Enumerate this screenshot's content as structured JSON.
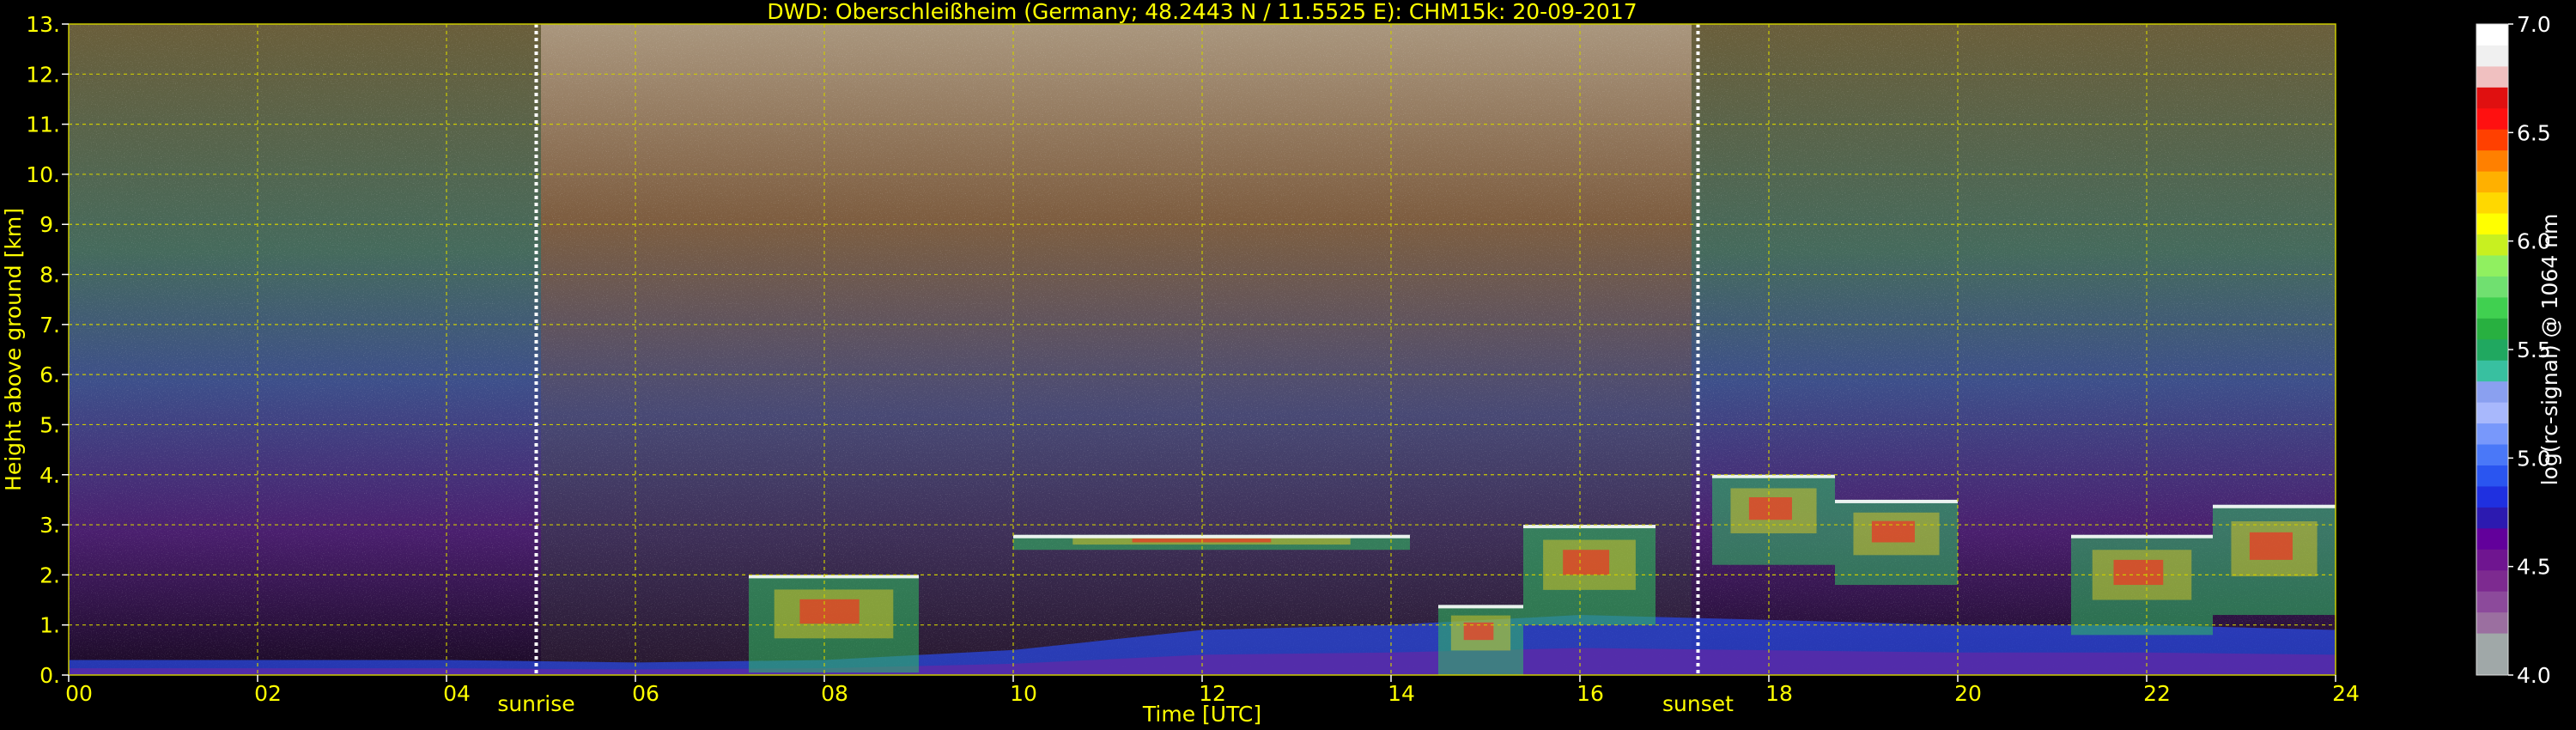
{
  "chart_data": {
    "type": "heatmap",
    "title": "DWD: Oberschleißheim (Germany; 48.2443 N / 11.5525 E):    CHM15k: 20-09-2017",
    "xlabel": "Time [UTC]",
    "ylabel": "Height above ground [km]",
    "xlim": [
      0,
      24
    ],
    "ylim": [
      0,
      13
    ],
    "x_ticks": [
      "00",
      "02",
      "04",
      "06",
      "08",
      "10",
      "12",
      "14",
      "16",
      "18",
      "20",
      "22",
      "24"
    ],
    "y_ticks": [
      "0.",
      "1.",
      "2.",
      "3.",
      "4.",
      "5.",
      "6.",
      "7.",
      "8.",
      "9.",
      "10.",
      "11.",
      "12.",
      "13."
    ],
    "grid": true,
    "annotations": [
      {
        "text": "sunrise",
        "x": 4.95
      },
      {
        "text": "sunset",
        "x": 17.25
      }
    ],
    "colorbar": {
      "label": "log(rc-signal) @ 1064 nm",
      "range": [
        4.0,
        7.0
      ],
      "ticks": [
        "4.0",
        "4.5",
        "5.0",
        "5.5",
        "6.0",
        "6.5",
        "7.0"
      ],
      "colors": [
        "#a0a8a8",
        "#a0a8a8",
        "#9b6fa0",
        "#8c4a9b",
        "#7d2a90",
        "#6f1590",
        "#62009b",
        "#2c1ab0",
        "#1f30e0",
        "#2a55f0",
        "#4a78f8",
        "#7898fb",
        "#a8b8fc",
        "#8aa0f0",
        "#38c0a0",
        "#20a860",
        "#28b040",
        "#40d050",
        "#70e070",
        "#90f060",
        "#c8f020",
        "#ffff00",
        "#ffd800",
        "#ffb000",
        "#ff8000",
        "#ff4000",
        "#ff1010",
        "#e01010",
        "#f0c0c0",
        "#f0f0f0",
        "#ffffff"
      ]
    },
    "features": {
      "boundary_layer_top_km": [
        {
          "t": 0.0,
          "h": 0.3
        },
        {
          "t": 2.0,
          "h": 0.3
        },
        {
          "t": 4.0,
          "h": 0.3
        },
        {
          "t": 6.0,
          "h": 0.25
        },
        {
          "t": 8.0,
          "h": 0.3
        },
        {
          "t": 10.0,
          "h": 0.5
        },
        {
          "t": 12.0,
          "h": 0.9
        },
        {
          "t": 14.0,
          "h": 1.0
        },
        {
          "t": 16.0,
          "h": 1.2
        },
        {
          "t": 18.0,
          "h": 1.1
        },
        {
          "t": 20.0,
          "h": 1.0
        },
        {
          "t": 22.0,
          "h": 1.0
        },
        {
          "t": 24.0,
          "h": 0.9
        }
      ],
      "cloud_layers": [
        {
          "t0": 7.2,
          "t1": 9.0,
          "base": 0.05,
          "top": 2.0
        },
        {
          "t0": 10.0,
          "t1": 14.2,
          "base": 2.5,
          "top": 2.8
        },
        {
          "t0": 14.5,
          "t1": 15.4,
          "base": 0.0,
          "top": 1.4
        },
        {
          "t0": 15.4,
          "t1": 16.8,
          "base": 1.0,
          "top": 3.0
        },
        {
          "t0": 17.4,
          "t1": 18.7,
          "base": 2.2,
          "top": 4.0
        },
        {
          "t0": 18.7,
          "t1": 20.0,
          "base": 1.8,
          "top": 3.5
        },
        {
          "t0": 21.2,
          "t1": 22.7,
          "base": 0.8,
          "top": 2.8
        },
        {
          "t0": 22.7,
          "t1": 24.0,
          "base": 1.2,
          "top": 3.4
        }
      ]
    }
  }
}
